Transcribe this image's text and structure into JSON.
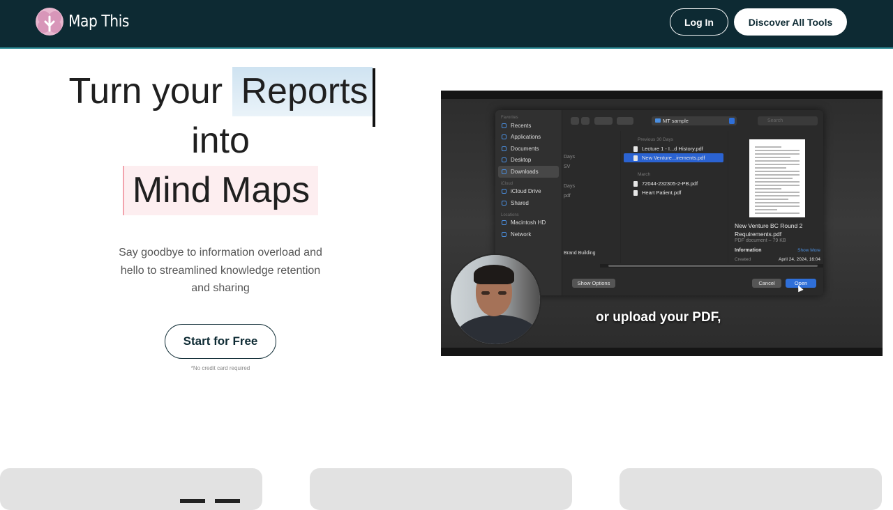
{
  "header": {
    "brand": "Map This",
    "login_label": "Log In",
    "discover_label": "Discover All Tools",
    "colors": {
      "background": "#0d2a33",
      "accent_line": "#2b8a94"
    }
  },
  "hero": {
    "title_part1": "Turn your",
    "title_highlight1": "Reports",
    "title_part2": "into",
    "title_highlight2": "Mind Maps",
    "subtitle": "Say goodbye to information overload and hello to streamlined knowledge retention and sharing",
    "cta_label": "Start for Free",
    "note": "*No credit card required"
  },
  "video": {
    "caption": "or upload your PDF,",
    "dialog": {
      "sidebar_favorites_header": "Favorites",
      "sidebar_items": [
        "Recents",
        "Applications",
        "Documents",
        "Desktop",
        "Downloads"
      ],
      "sidebar_cloud_header": "iCloud",
      "sidebar_cloud_items": [
        "iCloud Drive",
        "Shared"
      ],
      "sidebar_locations_header": "Locations",
      "sidebar_location_items": [
        "Macintosh HD",
        "Network"
      ],
      "path": "MT sample",
      "search_placeholder": "Search",
      "col_a_items": [
        "Days",
        "SV",
        "Days",
        "pdf",
        "Brand Building"
      ],
      "group1": "Previous 30 Days",
      "group1_files": [
        "Lecture 1 - I...d History.pdf",
        "New Venture...irements.pdf"
      ],
      "group2": "March",
      "group2_files": [
        "72044-232305-2-PB.pdf",
        "Heart Patient.pdf"
      ],
      "preview_title": "New Venture BC Round 2 Requirements.pdf",
      "preview_meta": "PDF document – 79 KB",
      "info_label": "Information",
      "show_more": "Show More",
      "created_label": "Created",
      "created_value": "April 24, 2024, 16:04",
      "show_options": "Show Options",
      "cancel": "Cancel",
      "open": "Open"
    }
  }
}
